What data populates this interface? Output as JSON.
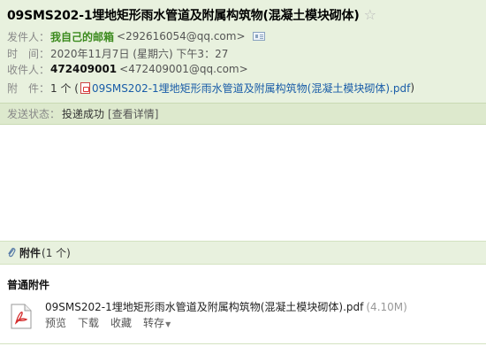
{
  "email": {
    "subject": "09SMS202-1埋地矩形雨水管道及附属构筑物(混凝土模块砌体)",
    "sender": {
      "label": "发件人：",
      "name": "我自己的邮箱",
      "address": "<292616054@qq.com>"
    },
    "time": {
      "label": "时　间：",
      "value": "2020年11月7日 (星期六) 下午3：27"
    },
    "recipient": {
      "label": "收件人：",
      "name": "472409001",
      "address": "<472409001@qq.com>"
    },
    "attachment_line": {
      "label": "附　件：",
      "count": "1 个 (",
      "file": "09SMS202-1埋地矩形雨水管道及附属构筑物(混凝土模块砌体).pdf",
      "close": ")"
    },
    "status": {
      "label": "发送状态：",
      "value": "投递成功",
      "detail": "[查看详情]"
    }
  },
  "attachments": {
    "title": "附件",
    "count": "(1 个)",
    "section_title": "普通附件",
    "files": [
      {
        "name": "09SMS202-1埋地矩形雨水管道及附属构筑物(混凝土模块砌体).pdf",
        "size": "(4.10M)",
        "actions": {
          "preview": "预览",
          "download": "下载",
          "favorite": "收藏",
          "save": "转存"
        }
      }
    ]
  },
  "colors": {
    "header_bg": "#e8f1de",
    "status_bg": "#dde9cd",
    "sender_green": "#3b8a1d",
    "link_blue": "#1a5da8"
  },
  "icons": {
    "star": "star-icon",
    "contact_card": "contact-card-icon",
    "pdf": "pdf-icon",
    "paperclip": "paperclip-icon",
    "dropdown": "chevron-down-icon"
  }
}
